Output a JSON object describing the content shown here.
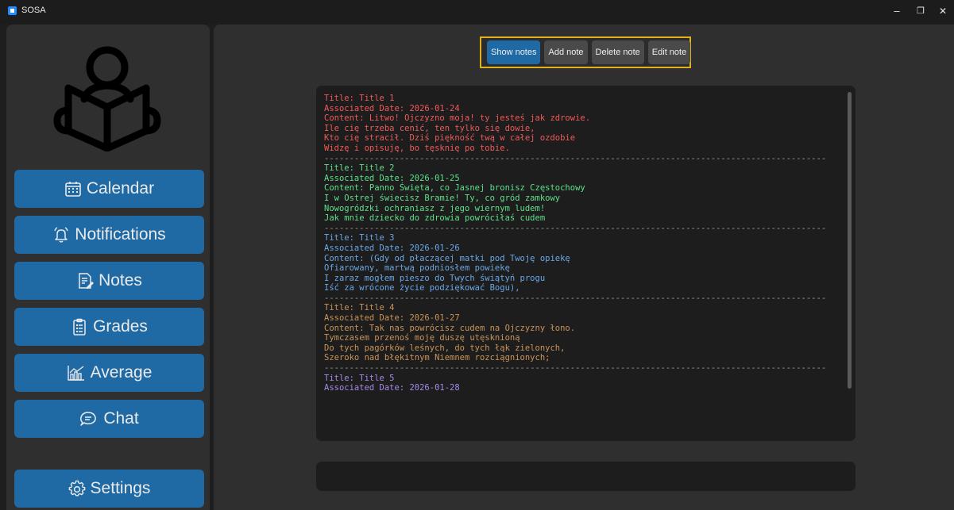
{
  "window": {
    "title": "SOSA",
    "minimize": "–",
    "restore": "❐",
    "close": "✕"
  },
  "sidebar": {
    "items": [
      {
        "label": "Calendar",
        "icon": "calendar-icon"
      },
      {
        "label": "Notifications",
        "icon": "bell-icon"
      },
      {
        "label": "Notes",
        "icon": "notes-icon"
      },
      {
        "label": "Grades",
        "icon": "grades-icon"
      },
      {
        "label": "Average",
        "icon": "chart-icon"
      },
      {
        "label": "Chat",
        "icon": "chat-icon"
      }
    ],
    "settings": {
      "label": "Settings",
      "icon": "gear-icon"
    }
  },
  "toolbar": {
    "show": "Show notes",
    "add": "Add note",
    "delete": "Delete note",
    "edit": "Edit note"
  },
  "separator": "----------------------------------------------------------------------------------------------------",
  "notes": [
    {
      "color": "#f05a5a",
      "title": "Title: Title 1",
      "date": "Associated Date: 2026-01-24",
      "lines": [
        "Content: Litwo! Ojczyzno moja! ty jesteś jak zdrowie.",
        "Ile cię trzeba cenić, ten tylko się dowie,",
        "Kto cię stracił. Dziś piękność twą w całej ozdobie",
        "Widzę i opisuję, bo tęsknię po tobie."
      ]
    },
    {
      "color": "#5fe08a",
      "title": "Title: Title 2",
      "date": "Associated Date: 2026-01-25",
      "lines": [
        "Content: Panno Święta, co Jasnej bronisz Częstochowy",
        "I w Ostrej świecisz Bramie! Ty, co gród zamkowy",
        "Nowogródzki ochraniasz z jego wiernym ludem!",
        "Jak mnie dziecko do zdrowia powróciłaś cudem"
      ]
    },
    {
      "color": "#6aa8e8",
      "title": "Title: Title 3",
      "date": "Associated Date: 2026-01-26",
      "lines": [
        "Content: (Gdy od płaczącej matki pod Twoję opiekę",
        "Ofiarowany, martwą podniosłem powiekę",
        "I zaraz mogłem pieszo do Twych świątyń progu",
        "Iść za wrócone życie podziękować Bogu),"
      ]
    },
    {
      "color": "#c9945a",
      "title": "Title: Title 4",
      "date": "Associated Date: 2026-01-27",
      "lines": [
        "Content: Tak nas powrócisz cudem na Ojczyzny łono.",
        "Tymczasem przenoś moję duszę utęsknioną",
        "Do tych pagórków leśnych, do tych łąk zielonych,",
        "Szeroko nad błękitnym Niemnem rozciągnionych;"
      ]
    },
    {
      "color": "#a58be8",
      "title": "Title: Title 5",
      "date": "Associated Date: 2026-01-28",
      "lines": []
    }
  ],
  "input": {
    "value": "",
    "placeholder": ""
  }
}
